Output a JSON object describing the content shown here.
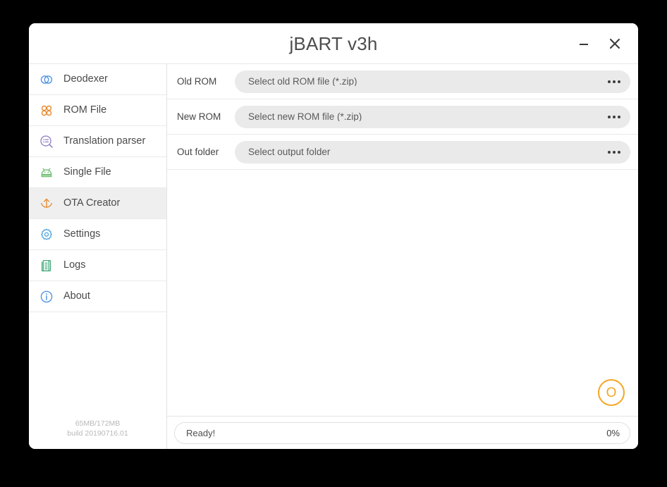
{
  "window": {
    "title": "jBART v3h",
    "minimize_label": "—",
    "close_label": "✕"
  },
  "sidebar": {
    "items": [
      {
        "label": "Deodexer",
        "icon": "link-circles-icon",
        "color": "#4a90e2",
        "selected": false
      },
      {
        "label": "ROM File",
        "icon": "four-circles-grid-icon",
        "color": "#e8892b",
        "selected": false
      },
      {
        "label": "Translation parser",
        "icon": "search-list-icon",
        "color": "#8e7cc3",
        "selected": false
      },
      {
        "label": "Single File",
        "icon": "android-robot-icon",
        "color": "#6fbf73",
        "selected": false
      },
      {
        "label": "OTA Creator",
        "icon": "upload-arrow-icon",
        "color": "#e8892b",
        "selected": true
      },
      {
        "label": "Settings",
        "icon": "gear-icon",
        "color": "#4aa3df",
        "selected": false
      },
      {
        "label": "Logs",
        "icon": "documents-icon",
        "color": "#3fa87a",
        "selected": false
      },
      {
        "label": "About",
        "icon": "info-circle-icon",
        "color": "#4a90e2",
        "selected": false
      }
    ],
    "footer": {
      "memory": "65MB/172MB",
      "build": "build 20190716.01"
    }
  },
  "main": {
    "fields": [
      {
        "label": "Old ROM",
        "value": "Select old ROM file (*.zip)",
        "browse_label": "..."
      },
      {
        "label": "New ROM",
        "value": "Select new ROM file (*.zip)",
        "browse_label": "..."
      },
      {
        "label": "Out folder",
        "value": "Select output folder",
        "browse_label": "..."
      }
    ],
    "run_button_label": "O"
  },
  "status": {
    "text": "Ready!",
    "percent": "0%"
  },
  "colors": {
    "accent": "#f5a623",
    "window_bg": "#ffffff",
    "desktop_bg": "#000000",
    "field_bg": "#eaeaea",
    "selected_bg": "#efefef"
  }
}
